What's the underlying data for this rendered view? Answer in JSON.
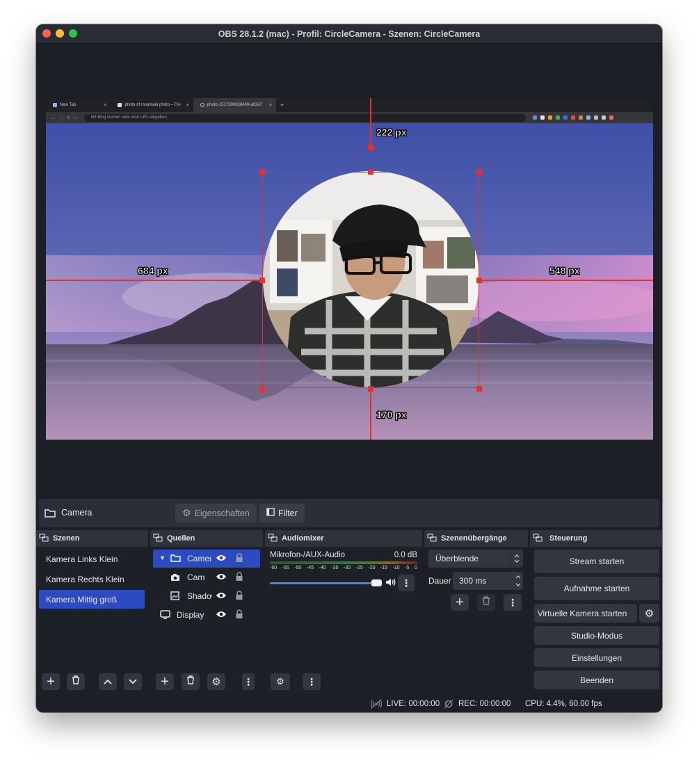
{
  "window": {
    "title": "OBS 28.1.2 (mac) - Profil: CircleCamera - Szenen: CircleCamera"
  },
  "preview": {
    "browser": {
      "tabs": [
        {
          "label": "New Tab"
        },
        {
          "label": "photo of mountain photo – Fre"
        },
        {
          "label": "photo-1517300638408-a63e7"
        }
      ],
      "url_placeholder": "Mit Bing suchen oder eine URL eingeben"
    },
    "measurements": {
      "top": "222 px",
      "left": "684 px",
      "right": "548 px",
      "bottom": "170 px"
    }
  },
  "source_bar": {
    "selected_source": "Camera",
    "properties_label": "Eigenschaften",
    "filter_label": "Filter"
  },
  "scenes": {
    "header": "Szenen",
    "items": [
      {
        "label": "Kamera Links Klein"
      },
      {
        "label": "Kamera Rechts Klein"
      },
      {
        "label": "Kamera Mittig groß"
      }
    ]
  },
  "sources": {
    "header": "Quellen",
    "items": [
      {
        "label": "Camera"
      },
      {
        "label": "Camera"
      },
      {
        "label": "Shadow"
      },
      {
        "label": "Display"
      }
    ]
  },
  "audio": {
    "header": "Audiomixer",
    "channel": "Mikrofon-/AUX-Audio",
    "level": "0.0 dB",
    "scale": [
      "-60",
      "-55",
      "-50",
      "-45",
      "-40",
      "-35",
      "-30",
      "-25",
      "-20",
      "-15",
      "-10",
      "-5",
      "0"
    ],
    "volume_fraction": 1.0
  },
  "transitions": {
    "header": "Szenenübergänge",
    "selected": "Überblende",
    "duration_label": "Dauer",
    "duration_value": "300 ms"
  },
  "controls": {
    "header": "Steuerung",
    "stream": "Stream starten",
    "record": "Aufnahme starten",
    "virtual_cam": "Virtuelle Kamera starten",
    "studio": "Studio-Modus",
    "settings": "Einstellungen",
    "quit": "Beenden"
  },
  "status": {
    "live": "LIVE: 00:00:00",
    "rec": "REC: 00:00:00",
    "cpu": "CPU: 4.4%, 60.00 fps"
  },
  "colors": {
    "accent": "#2d4bc0",
    "measure": "#e8302a",
    "window_bg": "#1d1f26"
  }
}
